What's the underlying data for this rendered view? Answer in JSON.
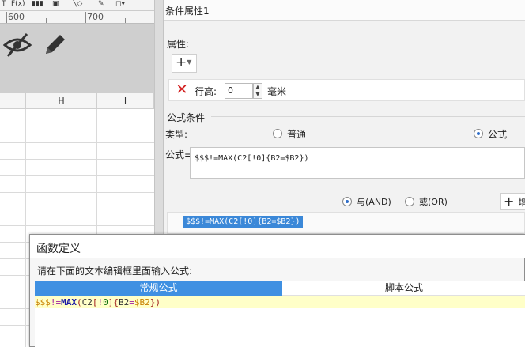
{
  "ruler": {
    "mark1": "600",
    "mark2": "700"
  },
  "toolbar": {
    "mini_label": "F(x)"
  },
  "sheet": {
    "col_h": "H",
    "col_i": "I"
  },
  "panel": {
    "title": "条件属性1",
    "property_group": "属性:",
    "row_height_label": "行高:",
    "row_height_value": "0",
    "row_height_unit": "毫米",
    "formula_group": "公式条件",
    "type_label": "类型:",
    "type_normal": "普通",
    "type_formula": "公式",
    "formula_label": "公式=",
    "formula_value": "$$$!=MAX(C2[!0]{B2=$B2})",
    "and_label": "与(AND)",
    "or_label": "或(OR)",
    "add_short": "增",
    "list_item": "$$$!=MAX(C2[!0]{B2=$B2})"
  },
  "dialog": {
    "title": "函数定义",
    "prompt": "请在下面的文本编辑框里面输入公式:",
    "tab_normal": "常规公式",
    "tab_script": "脚本公式",
    "code": {
      "dollar": "$$$",
      "op": "!=",
      "fn": "MAX",
      "p_open": "(",
      "c2": "C2",
      "b_open": "[",
      "not": "!",
      "zero": "0",
      "b_close": "]",
      "brace_open": "{",
      "b2": "B2",
      "eq": "=",
      "dollar_b2": "$B2",
      "brace_close": "}",
      "p_close": ")"
    }
  },
  "colors": {
    "accent": "#3f90e2",
    "delete": "#d32222",
    "highlight": "#ffffc8"
  }
}
